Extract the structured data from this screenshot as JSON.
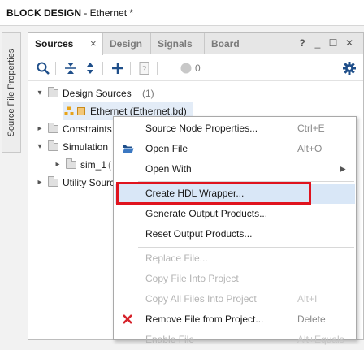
{
  "window": {
    "title_bold": "BLOCK DESIGN",
    "title_rest": " - Ethernet *"
  },
  "side_tab": {
    "label": "Source File Properties"
  },
  "tabs": [
    {
      "label": "Sources",
      "active": true
    },
    {
      "label": "Design",
      "active": false
    },
    {
      "label": "Signals",
      "active": false
    },
    {
      "label": "Board",
      "active": false
    }
  ],
  "tab_close": "×",
  "window_buttons": {
    "help": "?",
    "minimize": "_",
    "restore": "☐",
    "close": "✕"
  },
  "toolbar": {
    "badge_count": "0",
    "icons": [
      "search-icon",
      "collapse-all-icon",
      "expand-all-icon",
      "add-icon",
      "file-properties-icon",
      "status-circle-icon",
      "settings-gear-icon"
    ]
  },
  "tree": {
    "design_sources": {
      "label": "Design Sources",
      "count": "(1)"
    },
    "ethernet": {
      "label": "Ethernet (Ethernet.bd)"
    },
    "constraints": {
      "label": "Constraints"
    },
    "simulation": {
      "label": "Simulation"
    },
    "sim_1": {
      "label": "sim_1",
      "suffix": "("
    },
    "utility": {
      "label": "Utility Sourc"
    }
  },
  "context_menu": {
    "items": [
      {
        "label": "Source Node Properties...",
        "shortcut": "Ctrl+E",
        "enabled": true
      },
      {
        "label": "Open File",
        "shortcut": "Alt+O",
        "enabled": true,
        "icon": "open-folder-icon"
      },
      {
        "label": "Open With",
        "shortcut": "",
        "enabled": true,
        "submenu": true
      },
      {
        "label": "Create HDL Wrapper...",
        "shortcut": "",
        "enabled": true,
        "highlighted": true
      },
      {
        "label": "Generate Output Products...",
        "shortcut": "",
        "enabled": true
      },
      {
        "label": "Reset Output Products...",
        "shortcut": "",
        "enabled": true
      },
      {
        "label": "Replace File...",
        "shortcut": "",
        "enabled": false
      },
      {
        "label": "Copy File Into Project",
        "shortcut": "",
        "enabled": false
      },
      {
        "label": "Copy All Files Into Project",
        "shortcut": "Alt+I",
        "enabled": false
      },
      {
        "label": "Remove File from Project...",
        "shortcut": "Delete",
        "enabled": true,
        "icon": "remove-x-icon"
      },
      {
        "label": "Enable File",
        "shortcut": "Alt+Equals",
        "enabled": false
      }
    ]
  },
  "colors": {
    "highlight_box": "#e0141e",
    "accent_blue": "#1f6fbf",
    "remove_red": "#d6222a"
  }
}
